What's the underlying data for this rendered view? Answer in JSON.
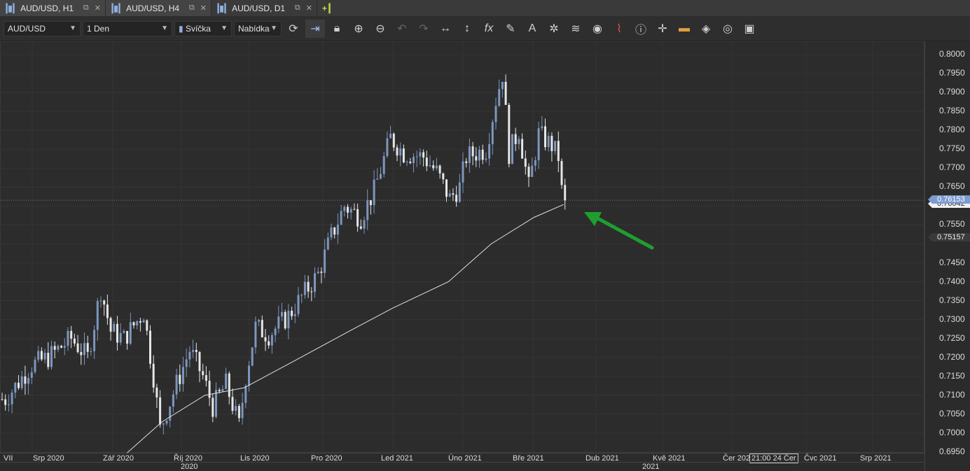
{
  "tabs": [
    {
      "label": "AUD/USD, H1"
    },
    {
      "label": "AUD/USD, H4"
    },
    {
      "label": "AUD/USD, D1",
      "active": true
    }
  ],
  "toolbar": {
    "symbol": "AUD/USD",
    "timeframe": "1 Den",
    "chart_type": "Svíčka",
    "price_type": "Nabídka"
  },
  "colors": {
    "bull": "#7d96bd",
    "bear": "#e6e6e6",
    "ma": "#e0e0e0",
    "arrow": "#1f9e2f",
    "bid_tag": "#7d9bd0"
  },
  "chart_data": {
    "type": "candlestick",
    "symbol": "AUD/USD",
    "timeframe": "D1",
    "ylim": [
      0.695,
      0.8
    ],
    "y_ticks": [
      "0.8000",
      "0.7950",
      "0.7900",
      "0.7850",
      "0.7800",
      "0.7750",
      "0.7700",
      "0.7650",
      "0.7550",
      "0.7450",
      "0.7400",
      "0.7350",
      "0.7300",
      "0.7250",
      "0.7200",
      "0.7150",
      "0.7100",
      "0.7050",
      "0.7000",
      "0.6950"
    ],
    "x_ticks": [
      "VII",
      "Srp 2020",
      "Zář 2020",
      "Říj 2020",
      "Lis 2020",
      "Pro 2020",
      "Led 2021",
      "Úno 2021",
      "Bře 2021",
      "Dub 2021",
      "Kvě 2021",
      "Čer 202",
      "Čvc 2021",
      "Srp 2021"
    ],
    "years": [
      "2020",
      "2021"
    ],
    "crosshair_time": "21:00 24 Čer",
    "price_tags": {
      "bid": "0.76153",
      "current": "0.76042",
      "ma": "0.75157"
    },
    "trend_closes": [
      [
        1,
        0.709
      ],
      [
        9,
        0.718
      ],
      [
        14,
        0.72
      ],
      [
        21,
        0.725
      ],
      [
        26,
        0.72
      ],
      [
        30,
        0.738
      ],
      [
        33,
        0.727
      ],
      [
        37,
        0.725
      ],
      [
        43,
        0.732
      ],
      [
        46,
        0.715
      ],
      [
        48,
        0.701
      ],
      [
        53,
        0.713
      ],
      [
        57,
        0.722
      ],
      [
        61,
        0.715
      ],
      [
        64,
        0.707
      ],
      [
        68,
        0.713
      ],
      [
        72,
        0.702
      ],
      [
        74,
        0.715
      ],
      [
        77,
        0.728
      ],
      [
        81,
        0.726
      ],
      [
        87,
        0.731
      ],
      [
        91,
        0.736
      ],
      [
        96,
        0.742
      ],
      [
        100,
        0.752
      ],
      [
        104,
        0.76
      ],
      [
        109,
        0.757
      ],
      [
        113,
        0.764
      ],
      [
        118,
        0.778
      ],
      [
        122,
        0.774
      ],
      [
        128,
        0.773
      ],
      [
        132,
        0.769
      ],
      [
        136,
        0.762
      ],
      [
        139,
        0.765
      ],
      [
        141,
        0.773
      ],
      [
        147,
        0.775
      ],
      [
        150,
        0.788
      ],
      [
        152,
        0.795
      ],
      [
        154,
        0.774
      ],
      [
        157,
        0.78
      ],
      [
        160,
        0.765
      ],
      [
        163,
        0.779
      ],
      [
        167,
        0.776
      ],
      [
        169,
        0.773
      ],
      [
        170,
        0.764
      ],
      [
        171,
        0.7615
      ]
    ],
    "moving_average": [
      [
        38,
        0.6945
      ],
      [
        49,
        0.703
      ],
      [
        62,
        0.71
      ],
      [
        74,
        0.712
      ],
      [
        89,
        0.719
      ],
      [
        106,
        0.727
      ],
      [
        119,
        0.733
      ],
      [
        136,
        0.74
      ],
      [
        149,
        0.75
      ],
      [
        162,
        0.757
      ],
      [
        171,
        0.7604
      ]
    ]
  }
}
